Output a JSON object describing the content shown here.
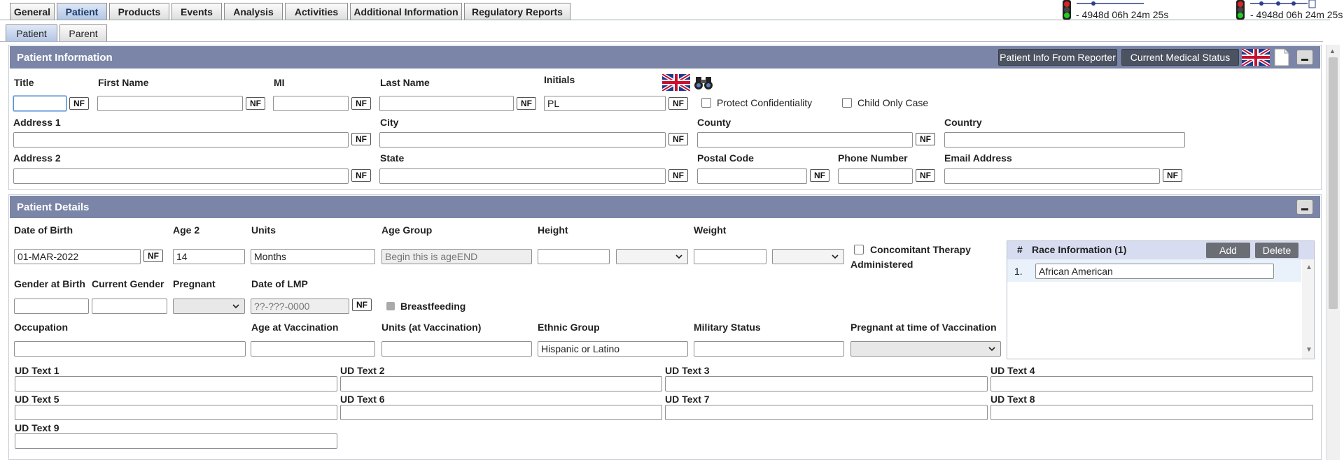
{
  "tabs": [
    "General",
    "Patient",
    "Products",
    "Events",
    "Analysis",
    "Activities",
    "Additional Information",
    "Regulatory Reports"
  ],
  "subtabs": [
    "Patient",
    "Parent"
  ],
  "timers": [
    "- 4948d 06h 24m 25s",
    "- 4948d 06h 24m 25s"
  ],
  "patient_info": {
    "title": "Patient Information",
    "btn_reporter": "Patient Info From Reporter",
    "btn_medical": "Current Medical Status",
    "labels": {
      "title": "Title",
      "first_name": "First Name",
      "mi": "MI",
      "last_name": "Last Name",
      "initials": "Initials",
      "protect": "Protect Confidentiality",
      "child": "Child Only Case",
      "address1": "Address 1",
      "city": "City",
      "county": "County",
      "country": "Country",
      "address2": "Address 2",
      "state": "State",
      "postal": "Postal Code",
      "phone": "Phone Number",
      "email": "Email Address"
    },
    "values": {
      "initials": "PL"
    }
  },
  "nf": "NF",
  "patient_details": {
    "title": "Patient Details",
    "labels": {
      "dob": "Date of Birth",
      "age2": "Age 2",
      "units": "Units",
      "age_group": "Age Group",
      "height": "Height",
      "weight": "Weight",
      "concomitant_1": "Concomitant Therapy",
      "concomitant_2": "Administered",
      "gender_birth": "Gender at Birth",
      "current_gender": "Current Gender",
      "pregnant": "Pregnant",
      "lmp": "Date of LMP",
      "breastfeeding": "Breastfeeding",
      "occupation": "Occupation",
      "age_vacc": "Age at Vaccination",
      "units_vacc": "Units (at Vaccination)",
      "ethnic": "Ethnic Group",
      "military": "Military Status",
      "pregnant_vacc": "Pregnant at time of Vaccination",
      "ud1": "UD Text 1",
      "ud2": "UD Text 2",
      "ud3": "UD Text 3",
      "ud4": "UD Text 4",
      "ud5": "UD Text 5",
      "ud6": "UD Text 6",
      "ud7": "UD Text 7",
      "ud8": "UD Text 8",
      "ud9": "UD Text 9"
    },
    "values": {
      "dob": "01-MAR-2022",
      "age2": "14",
      "units": "Months",
      "ethnic": "Hispanic or Latino"
    },
    "placeholders": {
      "age_group": "Begin this is ageEND",
      "lmp": "??-???-0000"
    }
  },
  "race": {
    "hash": "#",
    "header": "Race Information (1)",
    "add": "Add",
    "delete": "Delete",
    "rows": [
      {
        "num": "1.",
        "value": "African American"
      }
    ]
  }
}
